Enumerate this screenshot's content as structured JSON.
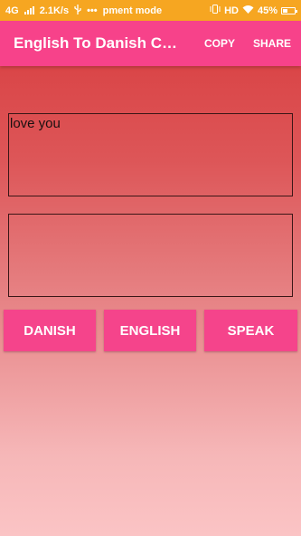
{
  "status_bar": {
    "network_type": "4G",
    "speed": "2.1K/s",
    "notification_text": "pment mode",
    "overflow_dots": "•••",
    "hd_label": "HD",
    "battery_percent": "45%",
    "battery_level": 0.45,
    "background_color": "#f6a621"
  },
  "app_bar": {
    "title": "English To Danish Co...",
    "copy_label": "COPY",
    "share_label": "SHARE",
    "color": "#f7428a"
  },
  "input_box": {
    "value": "love you"
  },
  "output_box": {
    "value": ""
  },
  "buttons": {
    "danish_label": "DANISH",
    "english_label": "ENGLISH",
    "speak_label": "SPEAK",
    "color": "#f5448b"
  },
  "icons": {
    "signal": "signal-icon",
    "usb": "usb-icon",
    "vibrate": "vibrate-icon",
    "wifi": "wifi-icon",
    "battery": "battery-icon"
  }
}
